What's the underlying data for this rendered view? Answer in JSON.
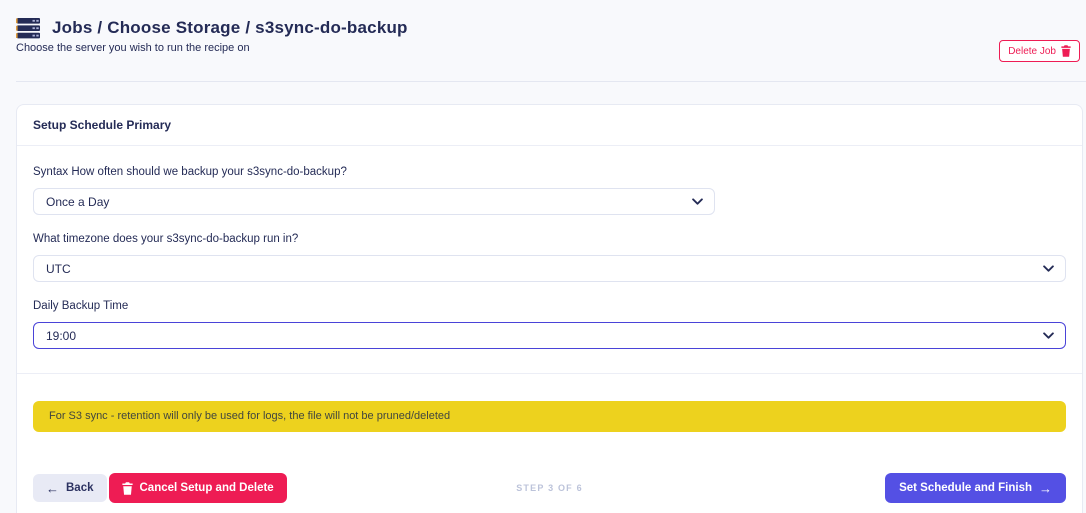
{
  "header": {
    "title": "Jobs / Choose Storage / s3sync-do-backup",
    "subtitle": "Choose the server you wish to run the recipe on",
    "delete_job_button": "Delete Job"
  },
  "card": {
    "title": "Setup Schedule Primary",
    "fields": {
      "frequency": {
        "label": "Syntax How often should we backup your s3sync-do-backup?",
        "value": "Once a Day"
      },
      "timezone": {
        "label": "What timezone does your s3sync-do-backup run in?",
        "value": "UTC"
      },
      "daily_time": {
        "label": "Daily Backup Time",
        "value": "19:00"
      }
    },
    "warning_banner": "For S3 sync - retention will only be used for logs, the file will not be pruned/deleted"
  },
  "footer": {
    "back_button": "Back",
    "back_arrow": "←",
    "cancel_button": "Cancel Setup and Delete",
    "step_indicator": "STEP 3 OF 6",
    "finish_button": "Set Schedule and Finish",
    "finish_arrow": "→"
  },
  "colors": {
    "accent": "#5450e4",
    "danger": "#ee1c54",
    "warning": "#edd21e",
    "text_navy": "#242b56"
  }
}
